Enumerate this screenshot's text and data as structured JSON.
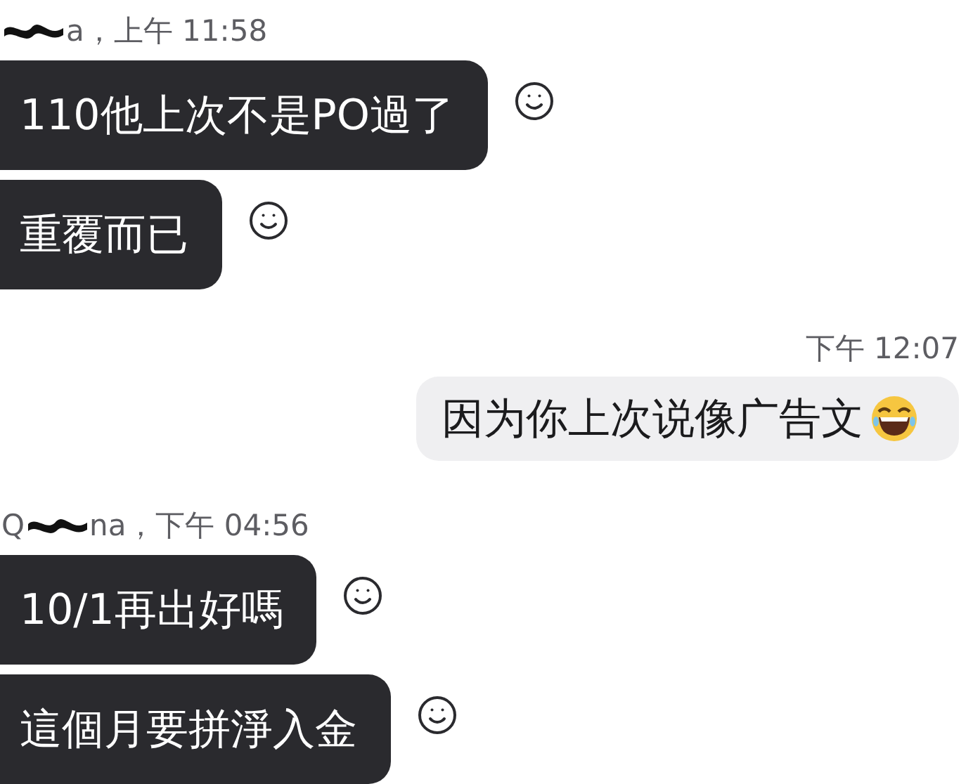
{
  "messages": [
    {
      "kind": "sender",
      "after": "a，上午 11:58"
    },
    {
      "kind": "incoming",
      "text": "110他上次不是PO過了"
    },
    {
      "kind": "incoming",
      "text": "重覆而已"
    },
    {
      "kind": "time",
      "text": "下午 12:07"
    },
    {
      "kind": "outgoing",
      "text": "因为你上次说像广告文",
      "emoji": true
    },
    {
      "kind": "sender",
      "before": "Q",
      "after": "na，下午 04:56"
    },
    {
      "kind": "incoming",
      "text": "10/1再出好嗎"
    },
    {
      "kind": "incoming",
      "text": "這個月要拼淨入金"
    }
  ]
}
